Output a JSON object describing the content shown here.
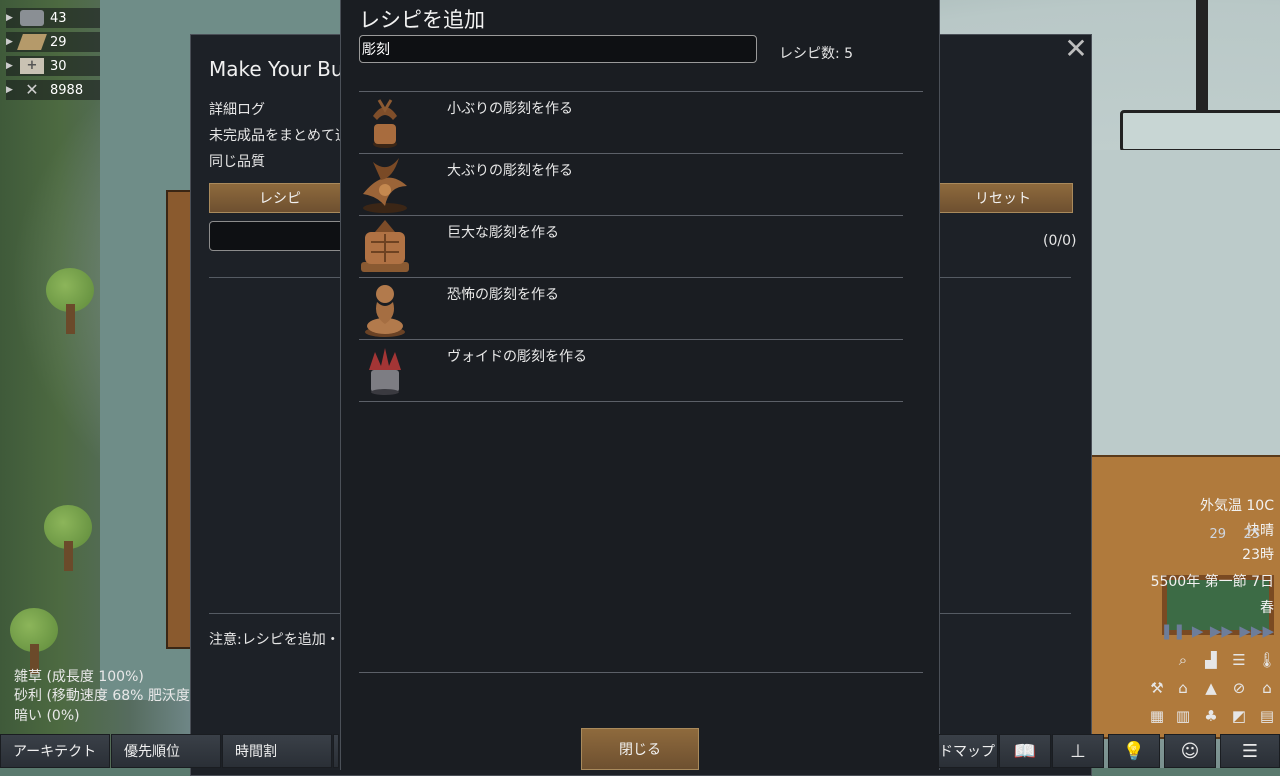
{
  "resources": [
    {
      "icon": "silver-icon",
      "value": "43"
    },
    {
      "icon": "wood-icon",
      "value": "29"
    },
    {
      "icon": "medicine-icon",
      "value": "30"
    },
    {
      "icon": "weapon-icon",
      "value": "8988"
    }
  ],
  "bill_window": {
    "title": "Make Your Bu",
    "lines": [
      "詳細ログ",
      "未完成品をまとめて追",
      "同じ品質"
    ],
    "recipe_button": "レシピ",
    "reset_button": "リセット",
    "counter": "(0/0)",
    "note": "注意:レシピを追加・"
  },
  "dialog": {
    "title": "レシピを追加",
    "search_value": "彫刻",
    "recipe_count": "レシピ数: 5",
    "recipes": [
      {
        "label": "小ぶりの彫刻を作る",
        "icon": "small-sculpture-icon"
      },
      {
        "label": "大ぶりの彫刻を作る",
        "icon": "large-sculpture-icon"
      },
      {
        "label": "巨大な彫刻を作る",
        "icon": "grand-sculpture-icon"
      },
      {
        "label": "恐怖の彫刻を作る",
        "icon": "horror-sculpture-icon"
      },
      {
        "label": "ヴォイドの彫刻を作る",
        "icon": "void-sculpture-icon"
      }
    ],
    "close_label": "閉じる"
  },
  "hud": {
    "outdoor_temp": "外気温 10C",
    "weather": "快晴",
    "hour": "23時",
    "date": "5500年 第一節 7日",
    "season": "春",
    "pawn_a": "29",
    "pawn_b": "25"
  },
  "inspect": {
    "line1": "雑草 (成長度 100%)",
    "line2": "砂利 (移動速度 68% 肥沃度",
    "line3": "暗い (0%)"
  },
  "bottom_tabs": [
    "アーキテクト",
    "優先順位",
    "時間割"
  ],
  "bottom_right_tab": "ドマップ",
  "colors": {
    "dialog_bg": "#1a1d22",
    "button_brown": "#7d5d36",
    "accent_green": "#3cc24a",
    "accent_red": "#d33a2e"
  }
}
